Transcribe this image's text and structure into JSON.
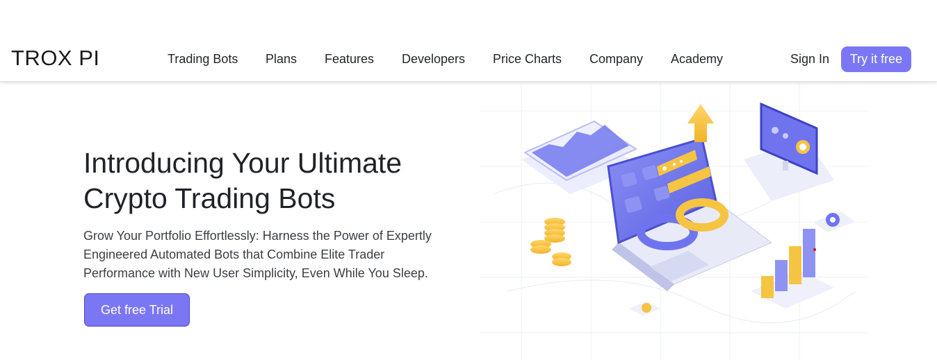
{
  "brand": {
    "logo": "TROX PI"
  },
  "nav": {
    "items": [
      {
        "label": "Trading Bots"
      },
      {
        "label": "Plans"
      },
      {
        "label": "Features"
      },
      {
        "label": "Developers"
      },
      {
        "label": "Price Charts"
      },
      {
        "label": "Company"
      },
      {
        "label": "Academy"
      }
    ],
    "sign_in": "Sign In",
    "try_free": "Try it free"
  },
  "hero": {
    "title_line1": "Introducing Your Ultimate",
    "title_line2": "Crypto Trading Bots",
    "subtitle": "Grow Your Portfolio Effortlessly: Harness the Power of Expertly Engineered Automated Bots that Combine Elite Trader Performance with New User Simplicity, Even While You Sleep.",
    "cta": "Get free Trial"
  },
  "colors": {
    "accent": "#7b77f4",
    "illustration_blue": "#6f74ee",
    "illustration_gold": "#f5c443"
  },
  "illustration": {
    "icons": [
      "laptop-icon",
      "monitor-icon",
      "tablet-chart-icon",
      "coin-stack-icon",
      "bar-chart-icon",
      "gear-icon",
      "arrow-up-icon",
      "chain-link-icon"
    ]
  }
}
